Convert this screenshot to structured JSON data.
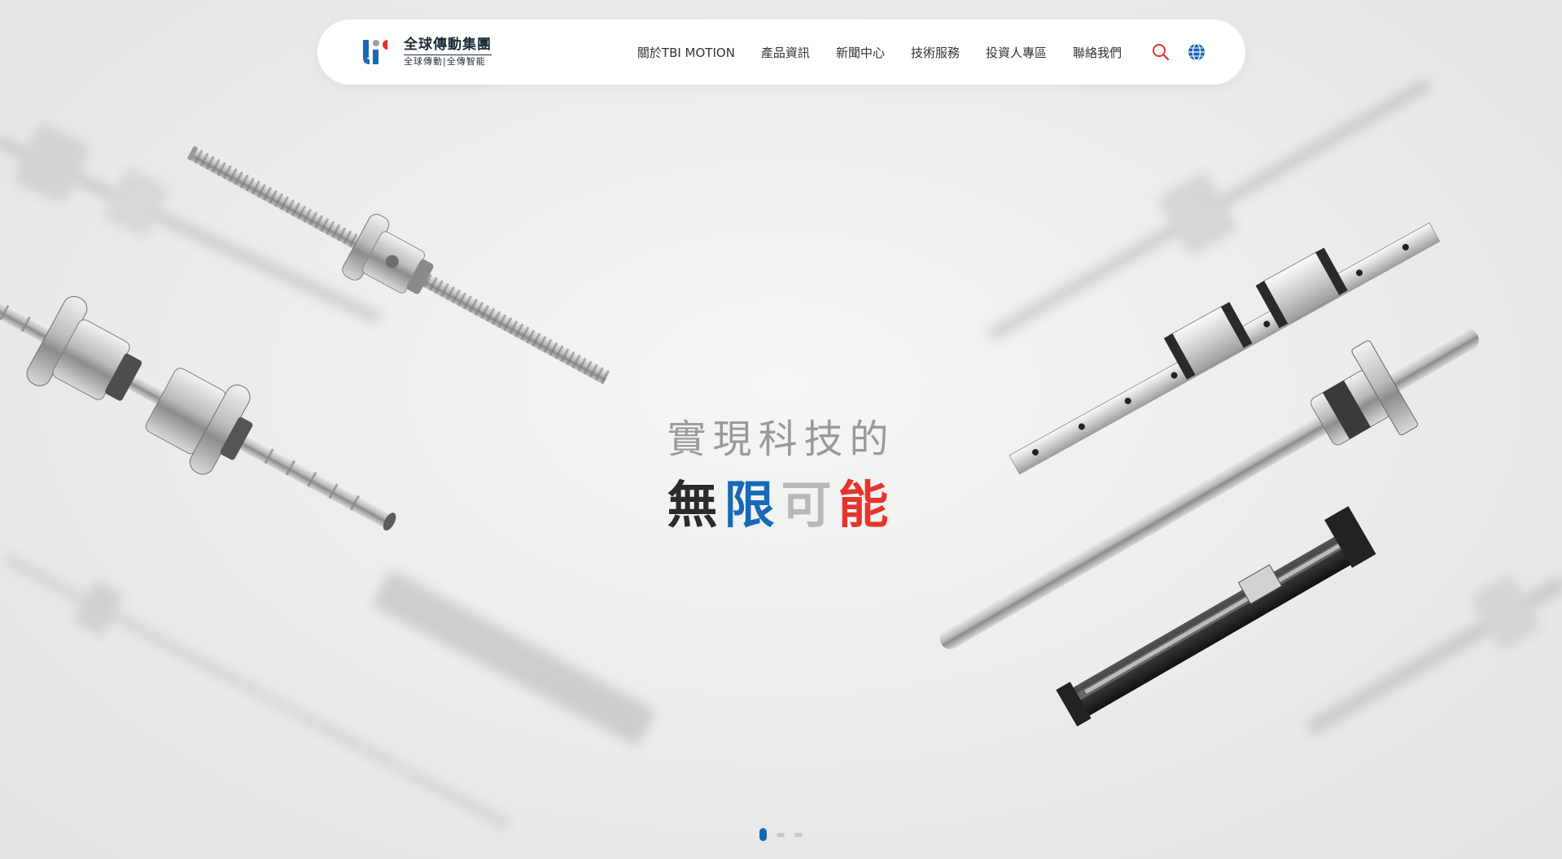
{
  "logo": {
    "name_cn": "全球傳動集團",
    "sub_cn": "全球傳動|全傳智能"
  },
  "nav": {
    "items": [
      {
        "label": "關於TBI MOTION"
      },
      {
        "label": "產品資訊"
      },
      {
        "label": "新聞中心"
      },
      {
        "label": "技術服務"
      },
      {
        "label": "投資人專區"
      },
      {
        "label": "聯絡我們"
      }
    ],
    "search_icon": "search-icon",
    "language_icon": "globe-icon"
  },
  "hero": {
    "line1": "實現科技的",
    "line2": [
      "無",
      "限",
      "可",
      "能"
    ]
  },
  "carousel": {
    "slides": 3,
    "active_index": 0
  },
  "colors": {
    "brand_blue": "#1769b8",
    "accent_red": "#e5352b",
    "search_red": "#e5352b"
  }
}
